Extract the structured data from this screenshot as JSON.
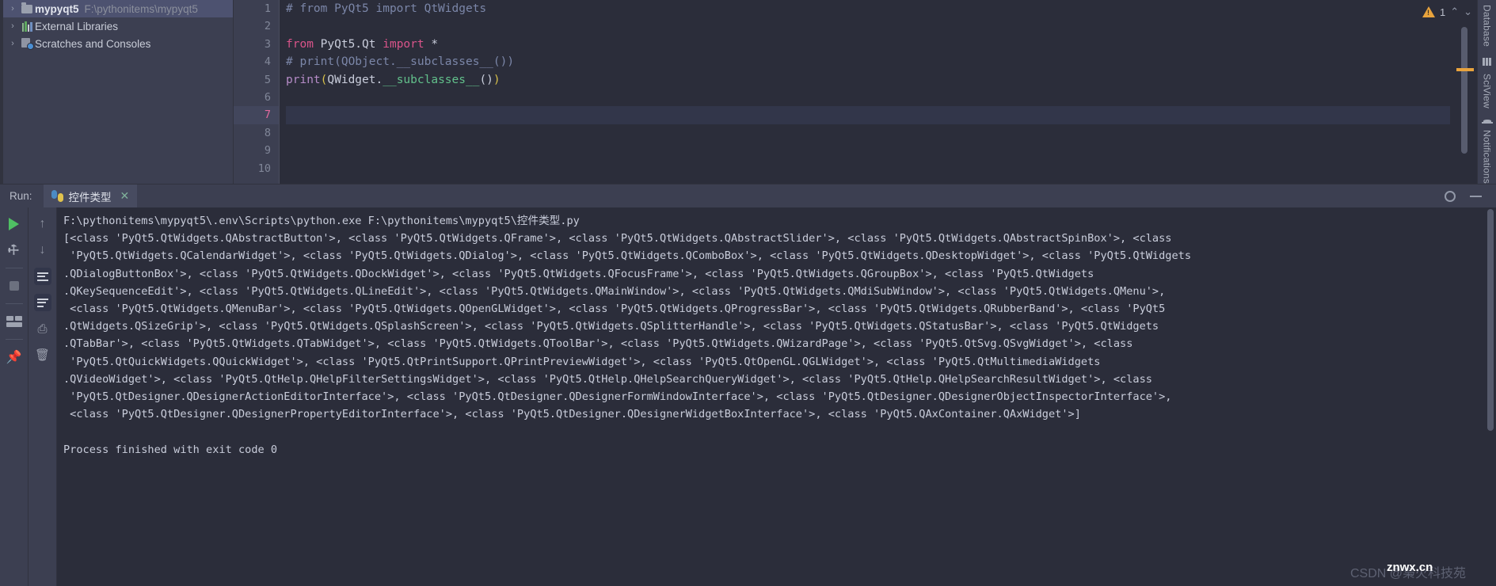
{
  "project": {
    "items": [
      {
        "chevron": "›",
        "icon": "folder-icon",
        "label": "mypyqt5",
        "path": "F:\\pythonitems\\mypyqt5",
        "selected": true
      },
      {
        "chevron": "›",
        "icon": "library-icon",
        "label": "External Libraries",
        "path": "",
        "selected": false
      },
      {
        "chevron": "›",
        "icon": "scratches-icon",
        "label": "Scratches and Consoles",
        "path": "",
        "selected": false
      }
    ]
  },
  "editor": {
    "line_numbers": [
      "1",
      "2",
      "3",
      "4",
      "5",
      "6",
      "7",
      "8",
      "9",
      "10"
    ],
    "current_line": "7",
    "lines": [
      {
        "n": 1,
        "segments": [
          {
            "t": "# from PyQt5 import QtWidgets",
            "c": "comment"
          }
        ]
      },
      {
        "n": 2,
        "segments": []
      },
      {
        "n": 3,
        "segments": [
          {
            "t": "from",
            "c": "kw"
          },
          {
            "t": " PyQt5.Qt ",
            "c": "plain"
          },
          {
            "t": "import",
            "c": "kw"
          },
          {
            "t": " *",
            "c": "plain"
          }
        ]
      },
      {
        "n": 4,
        "segments": [
          {
            "t": "# print(QObject.__subclasses__())",
            "c": "comment"
          }
        ]
      },
      {
        "n": 5,
        "segments": [
          {
            "t": "print",
            "c": "fn"
          },
          {
            "t": "(",
            "c": "paren"
          },
          {
            "t": "QWidget.",
            "c": "plain"
          },
          {
            "t": "__subclasses__",
            "c": "green"
          },
          {
            "t": "()",
            "c": "plain"
          },
          {
            "t": ")",
            "c": "paren"
          }
        ]
      },
      {
        "n": 6,
        "segments": []
      },
      {
        "n": 7,
        "segments": []
      },
      {
        "n": 8,
        "segments": []
      },
      {
        "n": 9,
        "segments": []
      },
      {
        "n": 10,
        "segments": []
      }
    ],
    "warning_count": "1",
    "prev_label": "⌃",
    "next_label": "⌄"
  },
  "right_bar": {
    "database_label": "Database",
    "sciview_label": "SciView",
    "notifications_label": "Notifications"
  },
  "run_panel": {
    "title": "Run:",
    "tab_label": "控件类型",
    "tab_close": "✕",
    "tools_left": [
      "run-icon",
      "wrench-icon",
      "stop-icon",
      "layout-icon",
      "pin-icon"
    ],
    "tools_right": [
      "arrow-up-icon",
      "arrow-down-icon",
      "soft-wrap-icon",
      "scroll-to-end-icon",
      "print-icon",
      "trash-icon"
    ],
    "settings_icon": "gear-icon",
    "minimize_icon": "minimize-icon"
  },
  "console": {
    "lines": [
      "F:\\pythonitems\\mypyqt5\\.env\\Scripts\\python.exe F:\\pythonitems\\mypyqt5\\控件类型.py",
      "[<class 'PyQt5.QtWidgets.QAbstractButton'>, <class 'PyQt5.QtWidgets.QFrame'>, <class 'PyQt5.QtWidgets.QAbstractSlider'>, <class 'PyQt5.QtWidgets.QAbstractSpinBox'>, <class",
      " 'PyQt5.QtWidgets.QCalendarWidget'>, <class 'PyQt5.QtWidgets.QDialog'>, <class 'PyQt5.QtWidgets.QComboBox'>, <class 'PyQt5.QtWidgets.QDesktopWidget'>, <class 'PyQt5.QtWidgets",
      ".QDialogButtonBox'>, <class 'PyQt5.QtWidgets.QDockWidget'>, <class 'PyQt5.QtWidgets.QFocusFrame'>, <class 'PyQt5.QtWidgets.QGroupBox'>, <class 'PyQt5.QtWidgets",
      ".QKeySequenceEdit'>, <class 'PyQt5.QtWidgets.QLineEdit'>, <class 'PyQt5.QtWidgets.QMainWindow'>, <class 'PyQt5.QtWidgets.QMdiSubWindow'>, <class 'PyQt5.QtWidgets.QMenu'>,",
      " <class 'PyQt5.QtWidgets.QMenuBar'>, <class 'PyQt5.QtWidgets.QOpenGLWidget'>, <class 'PyQt5.QtWidgets.QProgressBar'>, <class 'PyQt5.QtWidgets.QRubberBand'>, <class 'PyQt5",
      ".QtWidgets.QSizeGrip'>, <class 'PyQt5.QtWidgets.QSplashScreen'>, <class 'PyQt5.QtWidgets.QSplitterHandle'>, <class 'PyQt5.QtWidgets.QStatusBar'>, <class 'PyQt5.QtWidgets",
      ".QTabBar'>, <class 'PyQt5.QtWidgets.QTabWidget'>, <class 'PyQt5.QtWidgets.QToolBar'>, <class 'PyQt5.QtWidgets.QWizardPage'>, <class 'PyQt5.QtSvg.QSvgWidget'>, <class",
      " 'PyQt5.QtQuickWidgets.QQuickWidget'>, <class 'PyQt5.QtPrintSupport.QPrintPreviewWidget'>, <class 'PyQt5.QtOpenGL.QGLWidget'>, <class 'PyQt5.QtMultimediaWidgets",
      ".QVideoWidget'>, <class 'PyQt5.QtHelp.QHelpFilterSettingsWidget'>, <class 'PyQt5.QtHelp.QHelpSearchQueryWidget'>, <class 'PyQt5.QtHelp.QHelpSearchResultWidget'>, <class",
      " 'PyQt5.QtDesigner.QDesignerActionEditorInterface'>, <class 'PyQt5.QtDesigner.QDesignerFormWindowInterface'>, <class 'PyQt5.QtDesigner.QDesignerObjectInspectorInterface'>,",
      " <class 'PyQt5.QtDesigner.QDesignerPropertyEditorInterface'>, <class 'PyQt5.QtDesigner.QDesignerWidgetBoxInterface'>, <class 'PyQt5.QAxContainer.QAxWidget'>]",
      "",
      "Process finished with exit code 0"
    ]
  },
  "watermark": {
    "text": "CSDN @枭火科技苑",
    "overlay": "znwx.cn"
  },
  "colors": {
    "accent_warning": "#e8a33d",
    "run_green": "#4fbf63",
    "selection": "#4d5270",
    "editor_bg": "#2b2d3a",
    "panel_bg": "#3c3f51"
  }
}
